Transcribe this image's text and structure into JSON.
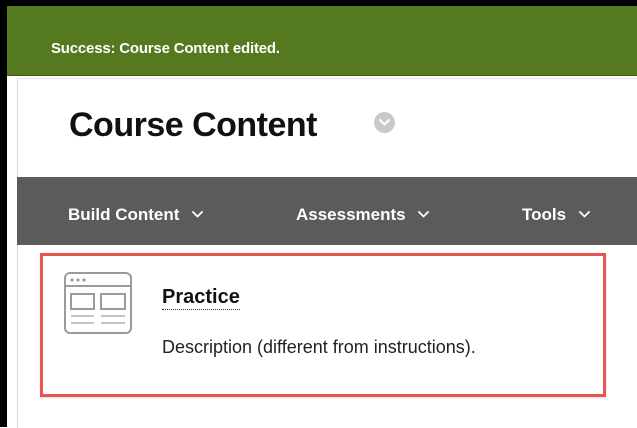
{
  "notification": {
    "message": "Success: Course Content edited."
  },
  "page": {
    "title": "Course Content"
  },
  "toolbar": {
    "items": [
      {
        "label": "Build Content",
        "icon": "chevron-down-icon"
      },
      {
        "label": "Assessments",
        "icon": "chevron-down-icon"
      },
      {
        "label": "Tools",
        "icon": "chevron-down-icon"
      }
    ]
  },
  "content_item": {
    "icon": "web-page-icon",
    "title": "Practice",
    "description": "Description (different from instructions)."
  },
  "colors": {
    "success_bar": "#55791f",
    "toolbar": "#5b5b5b",
    "highlight_border": "#e8564f"
  }
}
